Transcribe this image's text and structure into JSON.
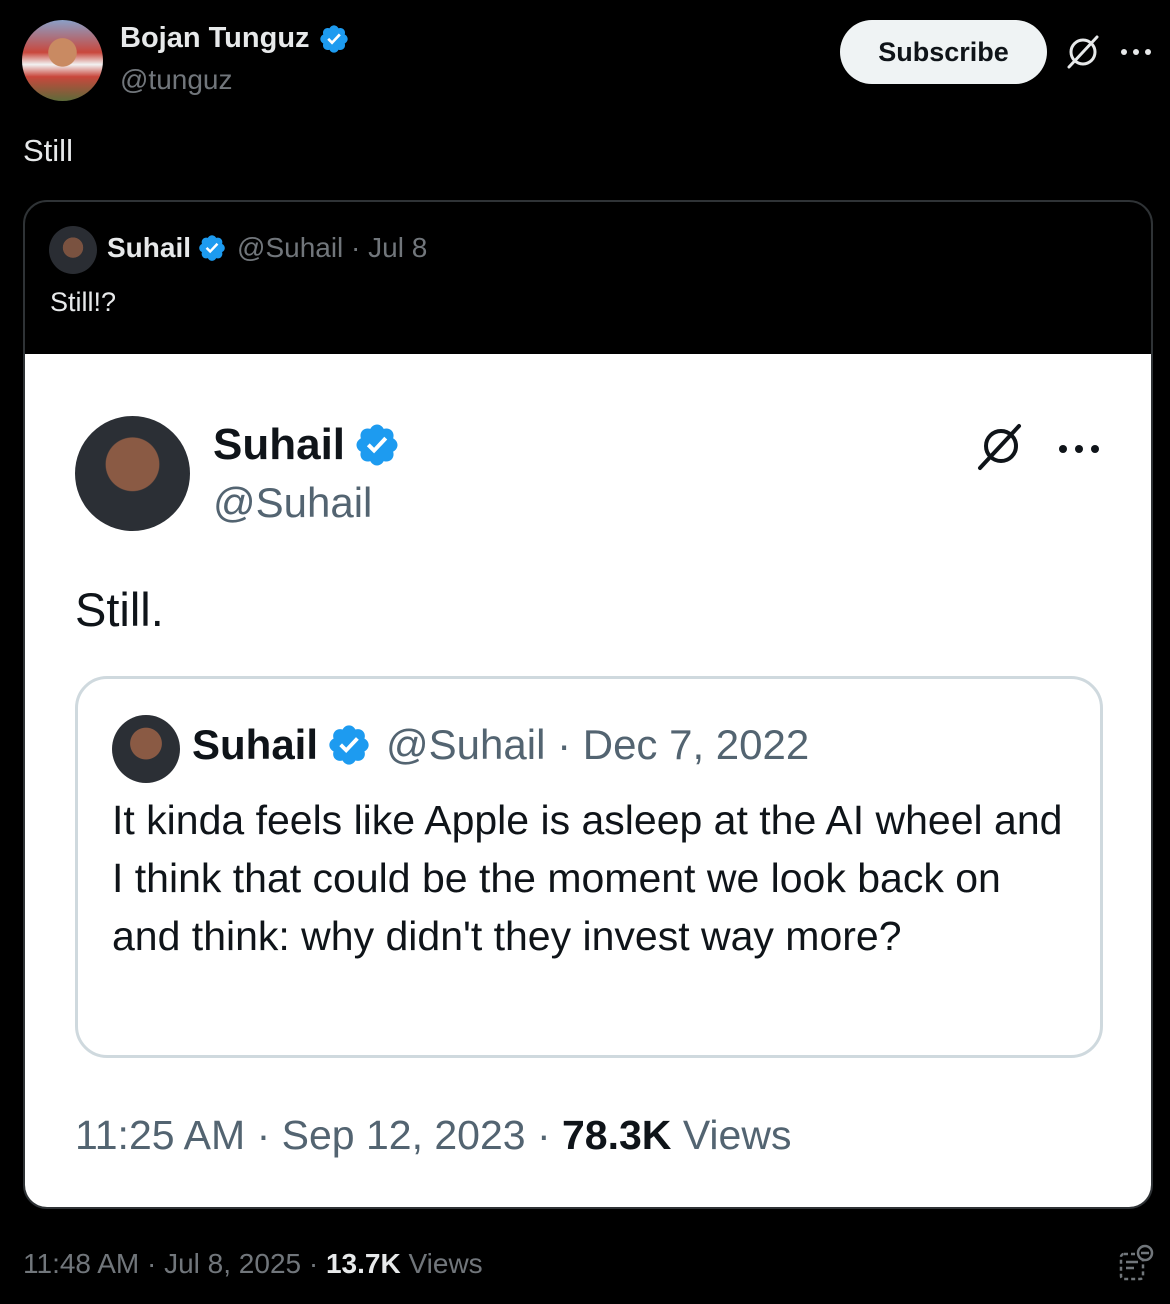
{
  "author": {
    "name": "Bojan Tunguz",
    "handle": "@tunguz"
  },
  "actions": {
    "subscribe_label": "Subscribe",
    "grok_icon": "grok-slash-icon",
    "more_icon": "more-dots-icon"
  },
  "tweet": {
    "text": "Still"
  },
  "quote": {
    "name": "Suhail",
    "meta": "@Suhail · Jul 8",
    "text": "Still!?",
    "screenshot": {
      "name": "Suhail",
      "handle": "@Suhail",
      "text": "Still.",
      "nested": {
        "name": "Suhail",
        "meta": "@Suhail · Dec 7, 2022",
        "text": "It kinda feels like Apple is asleep at the AI wheel and I think that could be the moment we look back on and think: why didn't they invest way more?"
      },
      "footer": {
        "time": "11:25 AM · Sep 12, 2023 · ",
        "views_count": "78.3K",
        "views_label": " Views"
      }
    }
  },
  "footer": {
    "time": "11:48 AM · Jul 8, 2025 · ",
    "views_count": "13.7K",
    "views_label": " Views"
  },
  "colors": {
    "background": "#000000",
    "verified": "#1d9bf0",
    "secondary_text": "#71767b"
  }
}
